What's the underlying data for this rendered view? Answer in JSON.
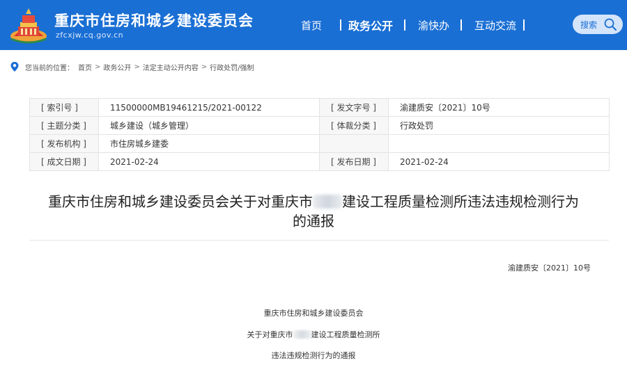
{
  "header": {
    "site_title": "重庆市住房和城乡建设委员会",
    "site_domain": "zfcxjw.cq.gov.cn",
    "logo_icon": "government-emblem-icon",
    "nav": [
      {
        "label": "首页"
      },
      {
        "label": "政务公开",
        "active": true
      },
      {
        "label": "渝快办"
      },
      {
        "label": "互动交流"
      }
    ],
    "search_label": "搜索",
    "colors": {
      "brand": "#1a6fd4"
    }
  },
  "breadcrumb": {
    "prefix": "您当前的位置：",
    "items": [
      "首页",
      "政务公开",
      "法定主动公开内容",
      "行政处罚/强制"
    ],
    "separator": ">"
  },
  "info_table": {
    "rows": [
      [
        {
          "label": "[ 索引号 ]",
          "value": "11500000MB19461215/2021-00122"
        },
        {
          "label": "[ 发文字号 ]",
          "value": "渝建质安〔2021〕10号"
        }
      ],
      [
        {
          "label": "[ 主题分类 ]",
          "value": "城乡建设（城乡管理）"
        },
        {
          "label": "[ 体裁分类 ]",
          "value": "行政处罚"
        }
      ],
      [
        {
          "label": "[ 发布机构 ]",
          "value": "市住房城乡建委"
        },
        {
          "label": "",
          "value": ""
        }
      ],
      [
        {
          "label": "[ 成文日期 ]",
          "value": "2021-02-24"
        },
        {
          "label": "[ 发布日期 ]",
          "value": "2021-02-24"
        }
      ]
    ]
  },
  "article": {
    "title_part1": "重庆市住房和城乡建设委员会关于对重庆市",
    "title_part2": "建设工程质量检测所违法违规检测行为",
    "title_line2": "的通报",
    "doc_number": "渝建质安〔2021〕10号",
    "body_line1": "重庆市住房和城乡建设委员会",
    "body_line2_part1": "关于对重庆市",
    "body_line2_part2": "建设工程质量检测所",
    "body_line3": "违法违规检测行为的通报"
  }
}
